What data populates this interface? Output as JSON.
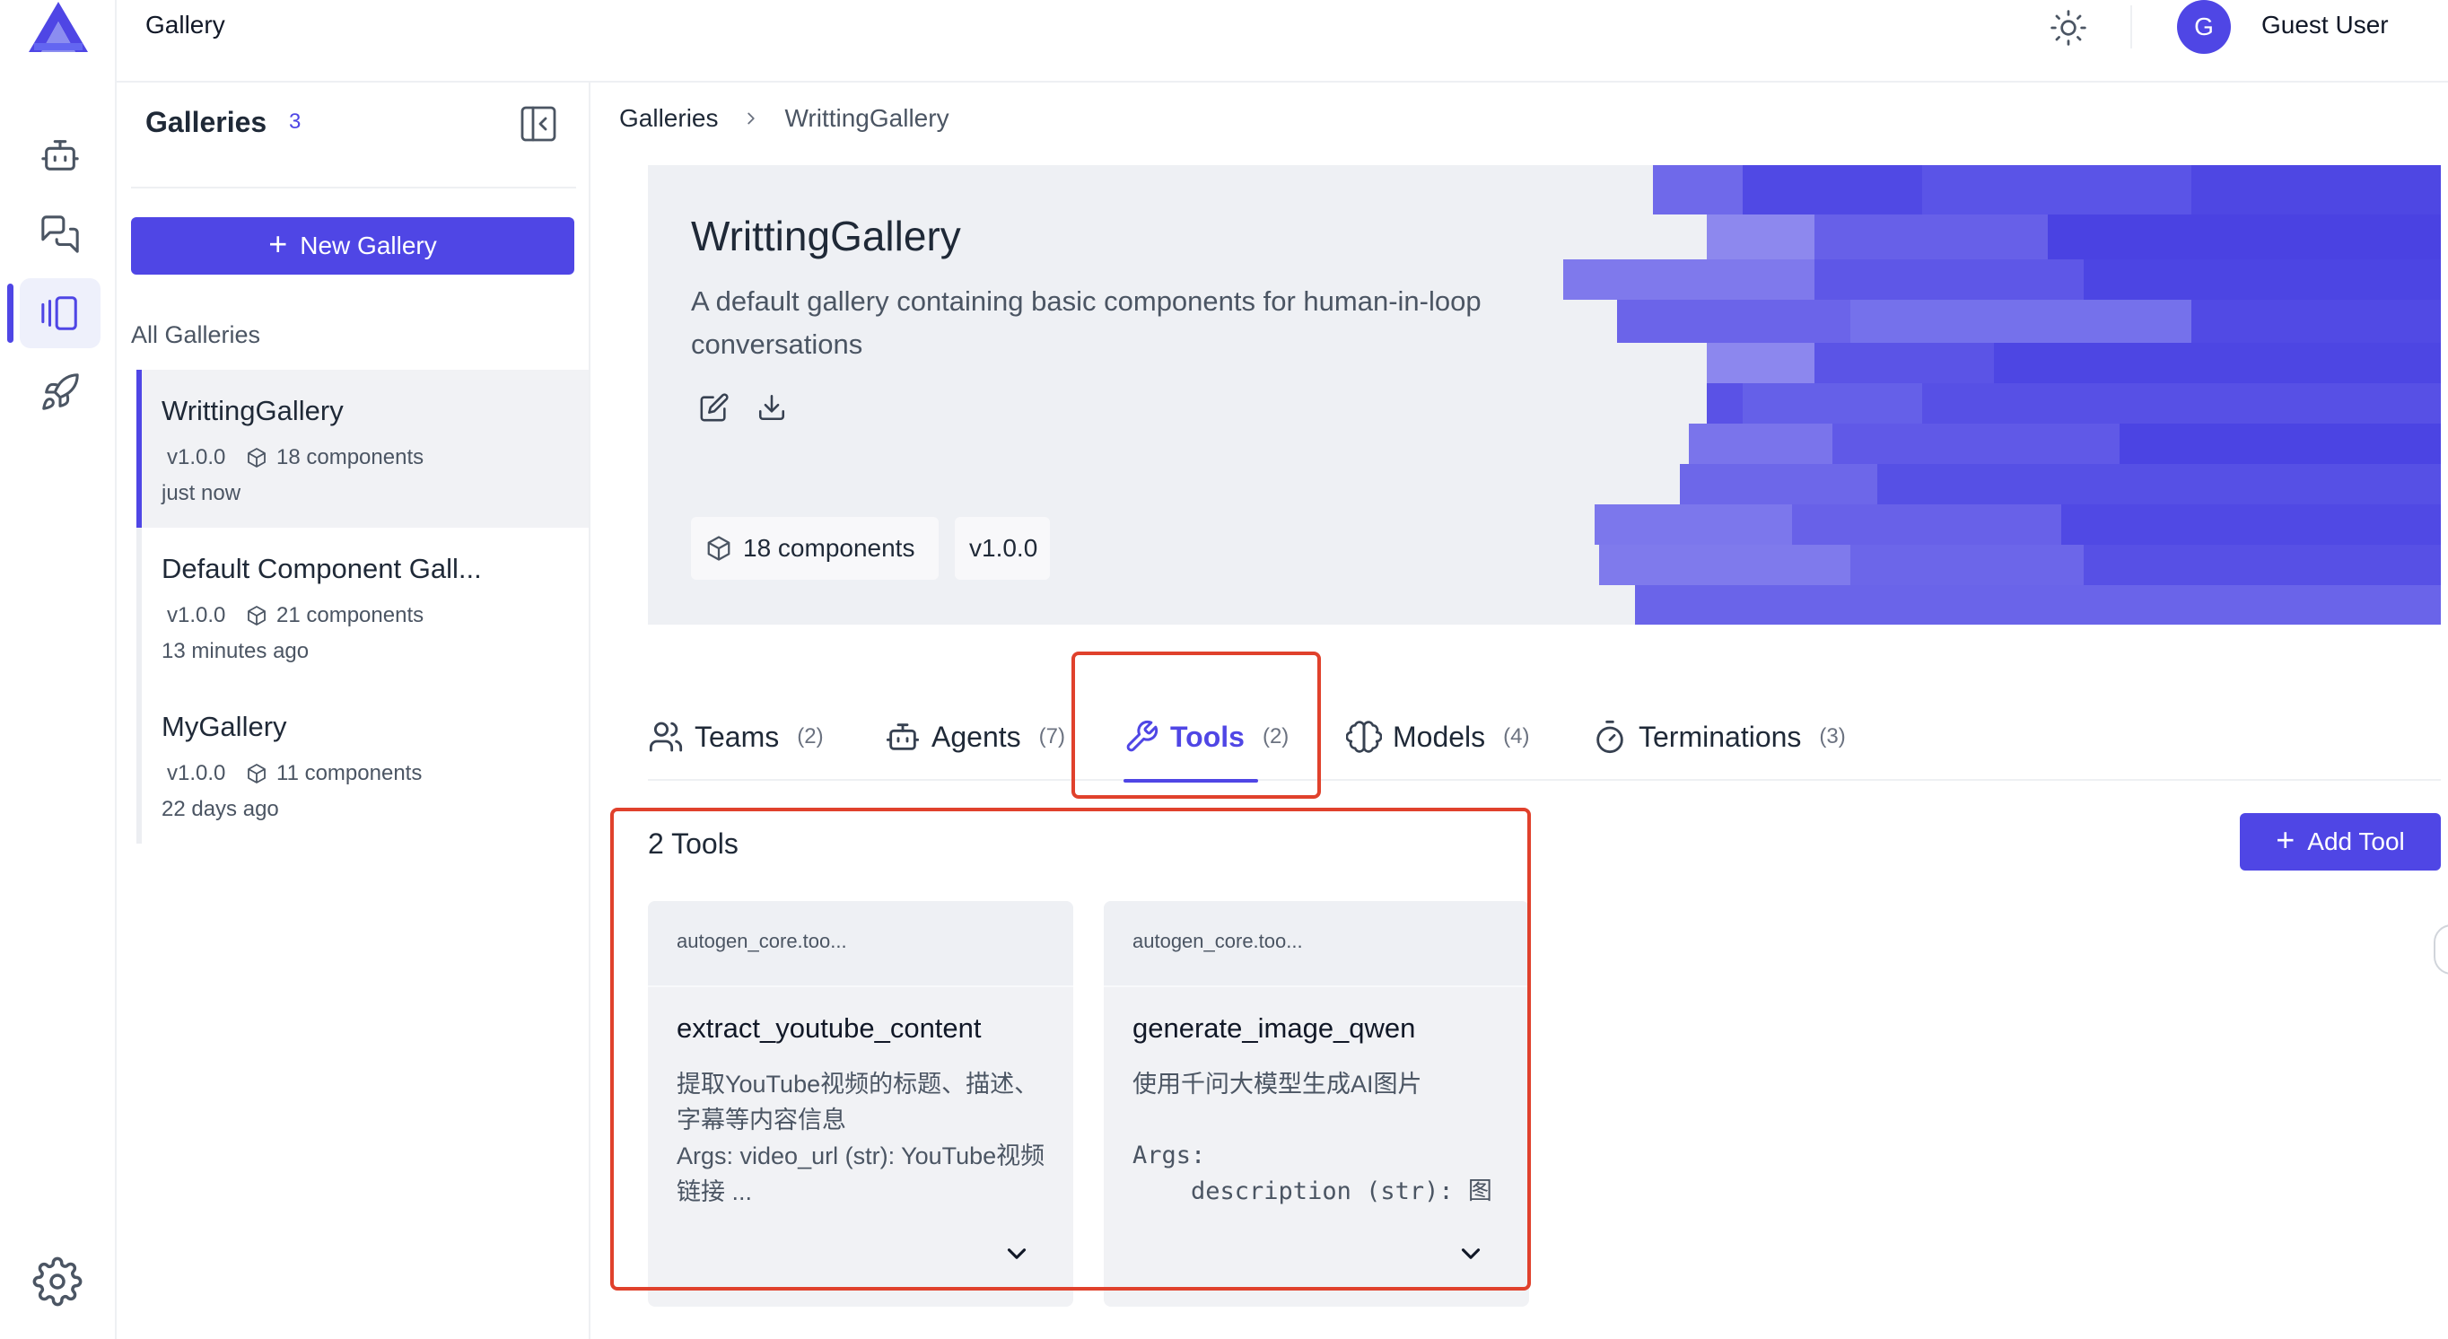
{
  "app": {
    "title": "Gallery"
  },
  "user": {
    "initial": "G",
    "name": "Guest User"
  },
  "sidebar": {
    "title": "Galleries",
    "count": "3",
    "new_button": "New Gallery",
    "section_label": "All Galleries",
    "items": [
      {
        "name": "WrittingGallery",
        "version": "v1.0.0",
        "components": "18 components",
        "time": "just now"
      },
      {
        "name": "Default Component Gall...",
        "version": "v1.0.0",
        "components": "21 components",
        "time": "13 minutes ago"
      },
      {
        "name": "MyGallery",
        "version": "v1.0.0",
        "components": "11 components",
        "time": "22 days ago"
      }
    ]
  },
  "breadcrumb": {
    "root": "Galleries",
    "current": "WrittingGallery"
  },
  "hero": {
    "title": "WrittingGallery",
    "description": "A default gallery containing basic components for human-in-loop conversations",
    "components_chip": "18 components",
    "version_chip": "v1.0.0",
    "accent_color": "#4f46e5"
  },
  "tabs": [
    {
      "label": "Teams",
      "count": "(2)",
      "icon": "users-icon"
    },
    {
      "label": "Agents",
      "count": "(7)",
      "icon": "bot-icon"
    },
    {
      "label": "Tools",
      "count": "(2)",
      "icon": "wrench-icon",
      "active": true
    },
    {
      "label": "Models",
      "count": "(4)",
      "icon": "brain-icon"
    },
    {
      "label": "Terminations",
      "count": "(3)",
      "icon": "timer-icon"
    }
  ],
  "tools": {
    "heading": "2 Tools",
    "add_button": "Add Tool",
    "cards": [
      {
        "provider": "autogen_core.too...",
        "name": "extract_youtube_content",
        "description": "提取YouTube视频的标题、描述、字幕等内容信息\nArgs: video_url (str): YouTube视频链接 ..."
      },
      {
        "provider": "autogen_core.too...",
        "name": "generate_image_qwen",
        "description_line": "使用千问大模型生成AI图片",
        "args_label": "Args:",
        "args_line": "    description (str): 图"
      }
    ]
  },
  "colors": {
    "primary": "#4f46e5",
    "highlight": "#e0412c"
  }
}
